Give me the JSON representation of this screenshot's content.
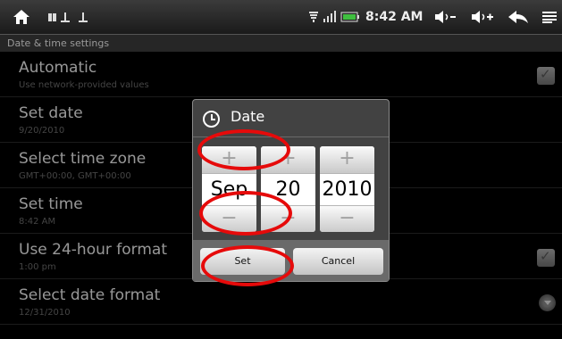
{
  "statusbar": {
    "time": "8:42 AM"
  },
  "breadcrumb": "Date & time settings",
  "settings": [
    {
      "title": "Automatic",
      "sub": "Use network-provided values"
    },
    {
      "title": "Set date",
      "sub": "9/20/2010"
    },
    {
      "title": "Select time zone",
      "sub": "GMT+00:00, GMT+00:00"
    },
    {
      "title": "Set time",
      "sub": "8:42 AM"
    },
    {
      "title": "Use 24-hour format",
      "sub": "1:00 pm"
    },
    {
      "title": "Select date format",
      "sub": "12/31/2010"
    }
  ],
  "dialog": {
    "title": "Date",
    "month": "Sep",
    "day": "20",
    "year": "2010",
    "plus": "+",
    "minus": "−",
    "set_label": "Set",
    "cancel_label": "Cancel"
  },
  "annotation_color": "#e60a0a"
}
